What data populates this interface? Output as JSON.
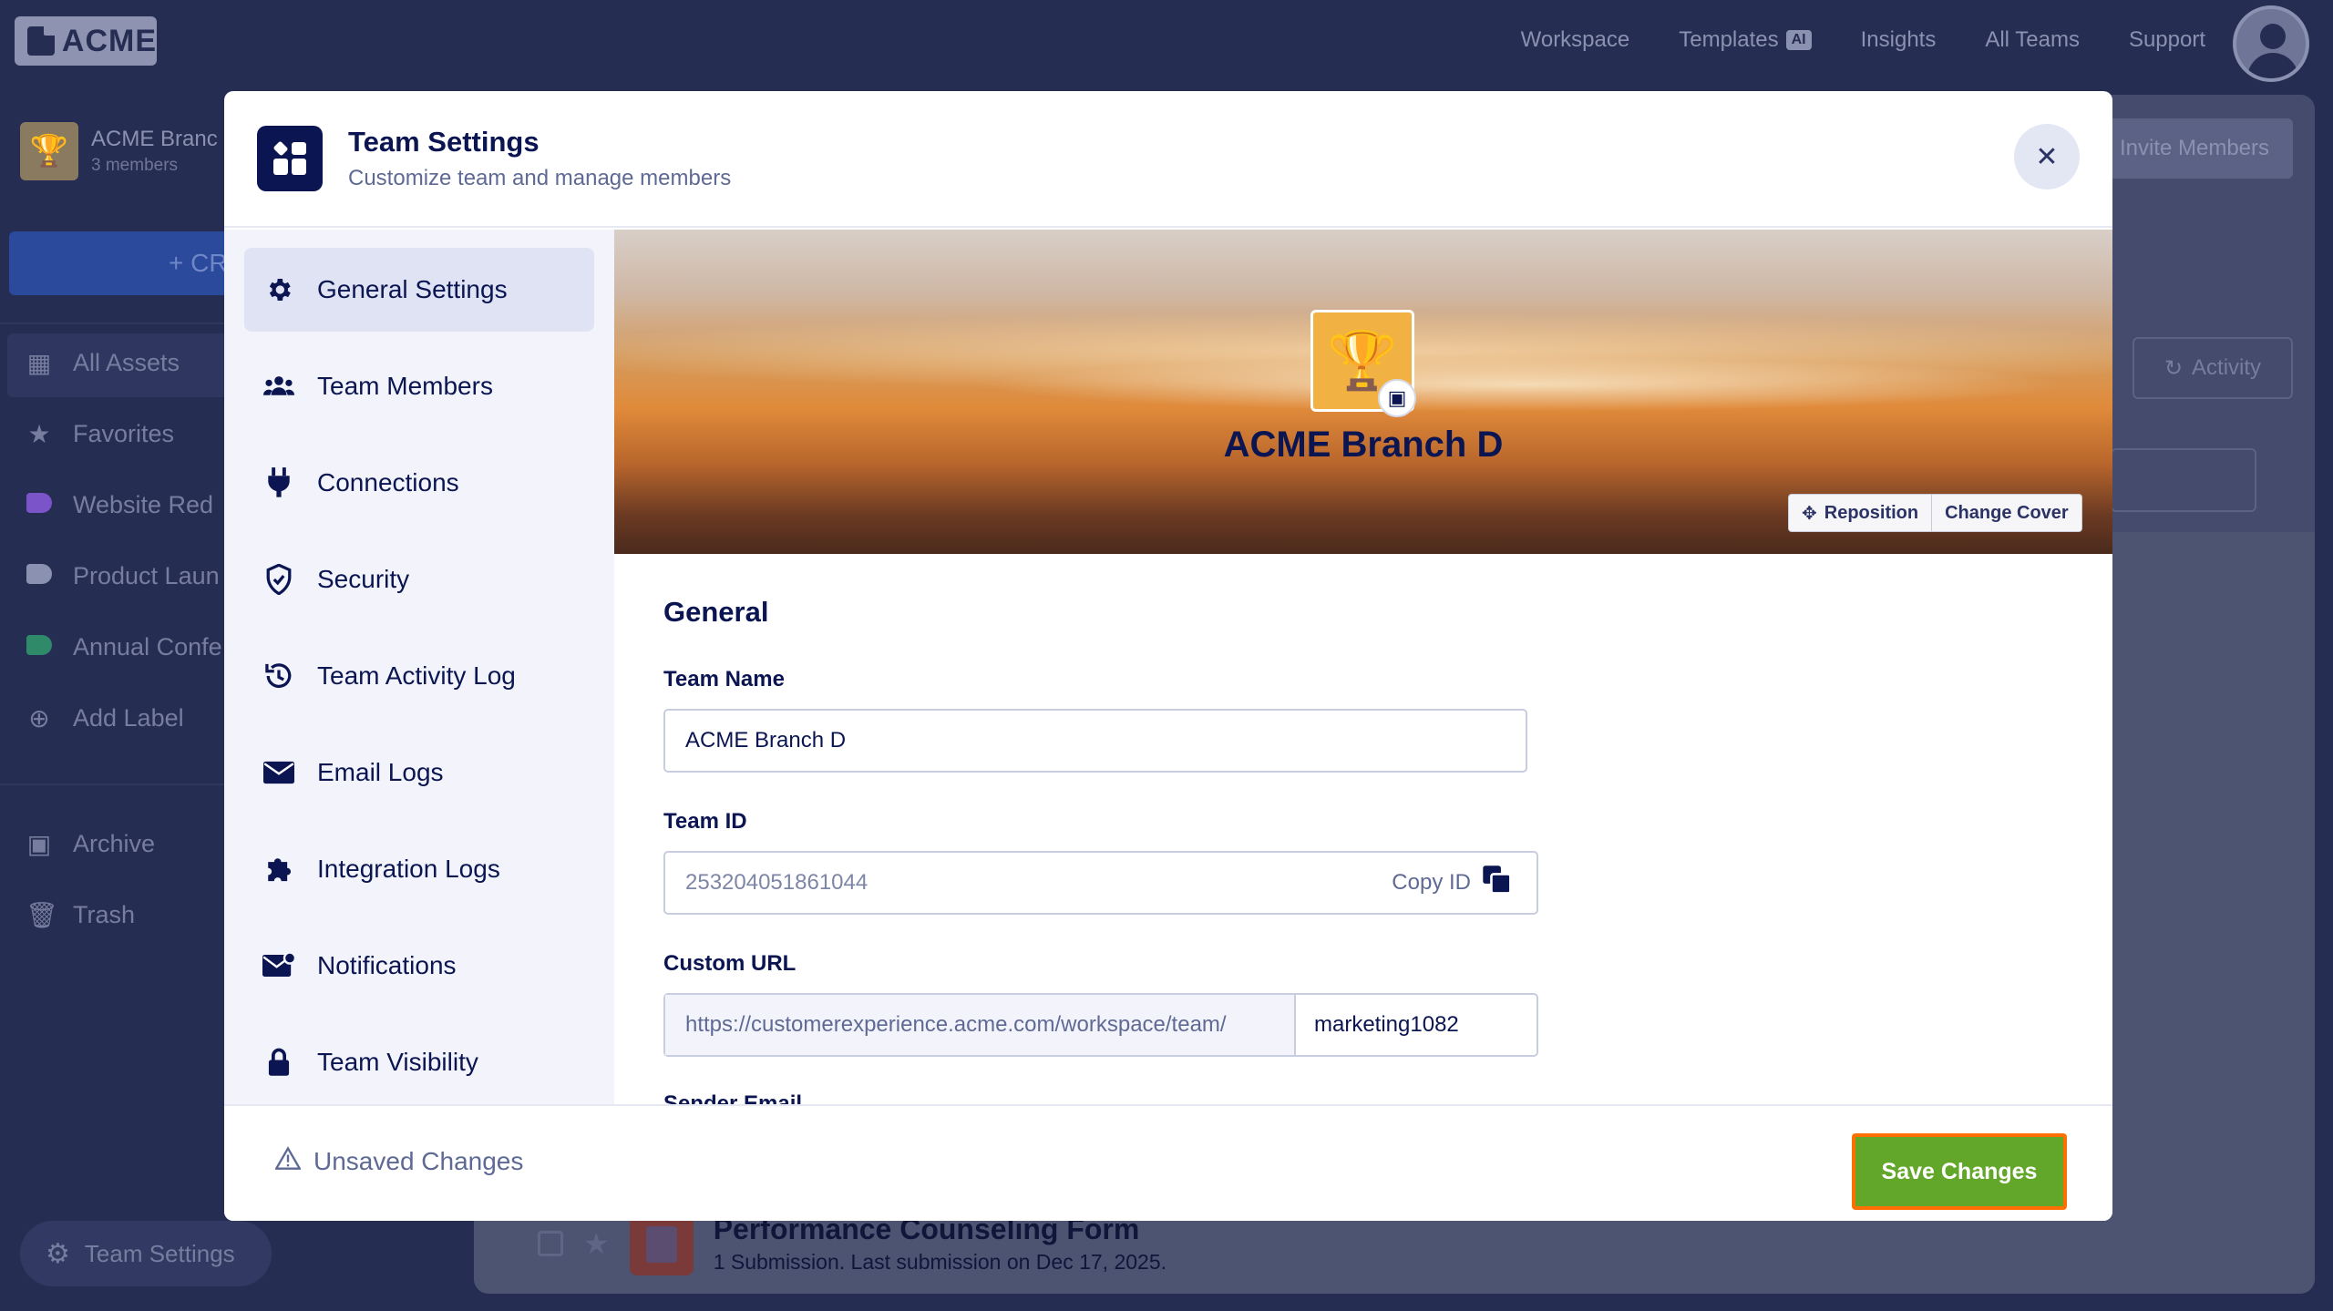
{
  "app": {
    "logo_text": "ACME",
    "nav": [
      {
        "label": "Workspace"
      },
      {
        "label": "Templates",
        "badge": "AI"
      },
      {
        "label": "Insights"
      },
      {
        "label": "All Teams"
      },
      {
        "label": "Support"
      }
    ]
  },
  "sidebar": {
    "team_name": "ACME Branc",
    "team_count": "3 members",
    "create_label": "+ CR",
    "items": [
      {
        "label": "All Assets",
        "icon": "grid-icon"
      },
      {
        "label": "Favorites",
        "icon": "star-icon"
      },
      {
        "label": "Website Red",
        "icon": "label-icon",
        "color": "#7a54c8"
      },
      {
        "label": "Product Laun",
        "icon": "label-icon",
        "color": "#8b91b0"
      },
      {
        "label": "Annual Confe",
        "icon": "label-icon",
        "color": "#2f8a6a"
      },
      {
        "label": "Add Label",
        "icon": "plus-circle-icon"
      },
      {
        "label": "Archive",
        "icon": "archive-icon"
      },
      {
        "label": "Trash",
        "icon": "trash-icon"
      }
    ],
    "team_settings_label": "Team Settings"
  },
  "main": {
    "invite_label": "Invite Members",
    "activity_label": "Activity",
    "form": {
      "title": "Performance Counseling Form",
      "subtitle": "1 Submission.  Last submission on Dec 17, 2025."
    }
  },
  "modal": {
    "title": "Team Settings",
    "subtitle": "Customize team and manage members",
    "menu": [
      {
        "label": "General Settings",
        "icon": "gear-icon",
        "active": true
      },
      {
        "label": "Team Members",
        "icon": "users-icon"
      },
      {
        "label": "Connections",
        "icon": "plug-icon"
      },
      {
        "label": "Security",
        "icon": "shield-icon"
      },
      {
        "label": "Team Activity Log",
        "icon": "history-icon"
      },
      {
        "label": "Email Logs",
        "icon": "envelope-icon"
      },
      {
        "label": "Integration Logs",
        "icon": "puzzle-icon"
      },
      {
        "label": "Notifications",
        "icon": "mail-notification-icon"
      },
      {
        "label": "Team Visibility",
        "icon": "lock-icon"
      }
    ],
    "cover": {
      "team_name": "ACME Branch D",
      "reposition_label": "Reposition",
      "change_cover_label": "Change Cover"
    },
    "general": {
      "section_title": "General",
      "team_name_label": "Team Name",
      "team_name_value": "ACME Branch D",
      "team_id_label": "Team ID",
      "team_id_value": "253204051861044",
      "copy_id_label": "Copy ID",
      "custom_url_label": "Custom URL",
      "custom_url_prefix": "https://customerexperience.acme.com/workspace/team/",
      "custom_url_value": "marketing1082",
      "next_label_cutoff": "Sender Email"
    },
    "footer": {
      "unsaved_label": "Unsaved Changes",
      "save_label": "Save Changes"
    }
  }
}
